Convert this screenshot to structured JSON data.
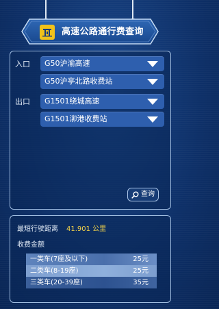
{
  "header": {
    "title": "高速公路通行费查询",
    "logo_icon": "toll-station-icon",
    "brand_color": "#f2c21a"
  },
  "entry": {
    "label": "入口",
    "highway_select": "G50沪渝高速",
    "station_select": "G50沪亭北路收费站"
  },
  "exit": {
    "label": "出口",
    "highway_select": "G1501绕城高速",
    "station_select": "G1501泖港收费站"
  },
  "query_button": {
    "label": "查询",
    "icon": "search-icon"
  },
  "result": {
    "distance_label": "最短行驶距离",
    "distance_value": "41.901 公里",
    "fee_label": "收费金额",
    "fees": [
      {
        "class": "一类车(7座及以下)",
        "price": "25元"
      },
      {
        "class": "二类车(8-19座)",
        "price": "25元"
      },
      {
        "class": "三类车(20-39座)",
        "price": "35元"
      }
    ]
  },
  "colors": {
    "background": "#0f3470",
    "select_fill": "#2e5fae",
    "distance_value": "#f3d34a"
  }
}
